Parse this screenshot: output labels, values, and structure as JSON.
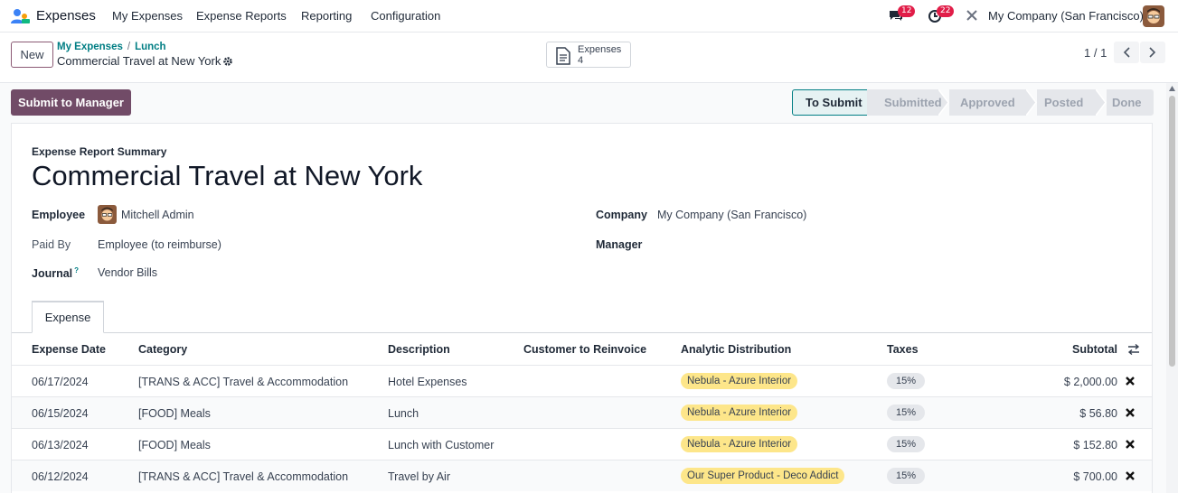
{
  "navbar": {
    "app_name": "Expenses",
    "menu": [
      "My Expenses",
      "Expense Reports",
      "Reporting",
      "Configuration"
    ],
    "messages_count": "12",
    "activities_count": "22",
    "company": "My Company (San Francisco)"
  },
  "control_panel": {
    "new_label": "New",
    "breadcrumb": [
      "My Expenses",
      "Lunch"
    ],
    "record_title": "Commercial Travel at New York",
    "smart_button": {
      "label": "Expenses",
      "value": "4"
    },
    "pager": "1 / 1"
  },
  "actions": {
    "submit_label": "Submit to Manager"
  },
  "statusbar": {
    "stages": [
      "To Submit",
      "Submitted",
      "Approved",
      "Posted",
      "Done"
    ],
    "active": "To Submit"
  },
  "form": {
    "summary_label": "Expense Report Summary",
    "title": "Commercial Travel at New York",
    "employee_label": "Employee",
    "employee_value": "Mitchell Admin",
    "paid_by_label": "Paid By",
    "paid_by_value": "Employee (to reimburse)",
    "journal_label": "Journal",
    "journal_help": "?",
    "journal_value": "Vendor Bills",
    "company_label": "Company",
    "company_value": "My Company (San Francisco)",
    "manager_label": "Manager"
  },
  "tabs": {
    "expense": "Expense"
  },
  "table": {
    "headers": {
      "date": "Expense Date",
      "category": "Category",
      "description": "Description",
      "customer": "Customer to Reinvoice",
      "analytic": "Analytic Distribution",
      "taxes": "Taxes",
      "subtotal": "Subtotal"
    },
    "rows": [
      {
        "date": "06/17/2024",
        "category": "[TRANS & ACC] Travel & Accommodation",
        "description": "Hotel Expenses",
        "customer": "",
        "analytic": "Nebula - Azure Interior",
        "taxes": "15%",
        "subtotal": "$ 2,000.00"
      },
      {
        "date": "06/15/2024",
        "category": "[FOOD] Meals",
        "description": "Lunch",
        "customer": "",
        "analytic": "Nebula - Azure Interior",
        "taxes": "15%",
        "subtotal": "$ 56.80"
      },
      {
        "date": "06/13/2024",
        "category": "[FOOD] Meals",
        "description": "Lunch with Customer",
        "customer": "",
        "analytic": "Nebula - Azure Interior",
        "taxes": "15%",
        "subtotal": "$ 152.80"
      },
      {
        "date": "06/12/2024",
        "category": "[TRANS & ACC] Travel & Accommodation",
        "description": "Travel by Air",
        "customer": "",
        "analytic": "Our Super Product - Deco Addict",
        "taxes": "15%",
        "subtotal": "$ 700.00"
      }
    ]
  },
  "colors": {
    "brand": "#714b67",
    "accent": "#017e84",
    "tag": "#fde68a",
    "badge": "#e11d48"
  }
}
